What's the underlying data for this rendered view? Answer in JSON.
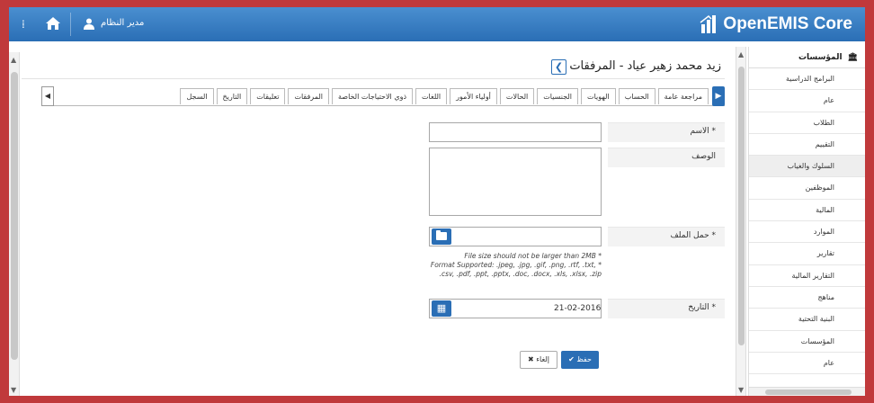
{
  "topbar": {
    "menu_icon": "⁞",
    "user_name": "مدير النظام",
    "brand_name": "OpenEMIS Core"
  },
  "page": {
    "title": "زيد محمد زهير عياد - المرفقات",
    "back_symbol": "❮"
  },
  "tabs": [
    "مراجعة عامة",
    "الحساب",
    "الهويات",
    "الجنسيات",
    "الحالات",
    "أولياء الأمور",
    "اللغات",
    "ذوي الاحتياجات الخاصة",
    "المرفقات",
    "تعليقات",
    "التاريخ",
    "السجل"
  ],
  "tab_scroll": {
    "left": "◀",
    "right": "▶"
  },
  "form": {
    "name_label": "* الاسم",
    "name_value": "",
    "description_label": "الوصف",
    "description_value": "",
    "file_label": "* حمل الملف",
    "file_value": "",
    "file_hint_line1": "File size should not be larger than 2MB *",
    "file_hint_line2": "Format Supported: .jpeg, .jpg, .gif, .png, .rtf, .txt, *",
    "file_hint_line3": ".csv, .pdf, .ppt, .pptx, .doc, .docx, .xls, .xlsx, .zip",
    "date_label": "* التاريخ",
    "date_value": "21-02-2016",
    "save_label": "حفظ",
    "cancel_label": "إلغاء",
    "cancel_symbol": "✖",
    "save_symbol": "✔"
  },
  "sidebar": {
    "header": "المؤسسات",
    "items": [
      "المؤسسات",
      "البرامج الدراسية",
      "عام",
      "الطلاب",
      "التقييم",
      "السلوك والغياب",
      "الموظفين",
      "المالية",
      "الموارد",
      "تقارير",
      "التقارير المالية",
      "مناهج",
      "البنية التحتية"
    ],
    "active_index": 4
  },
  "colors": {
    "brand": "#2a6eb5",
    "frame": "#c0393b"
  }
}
